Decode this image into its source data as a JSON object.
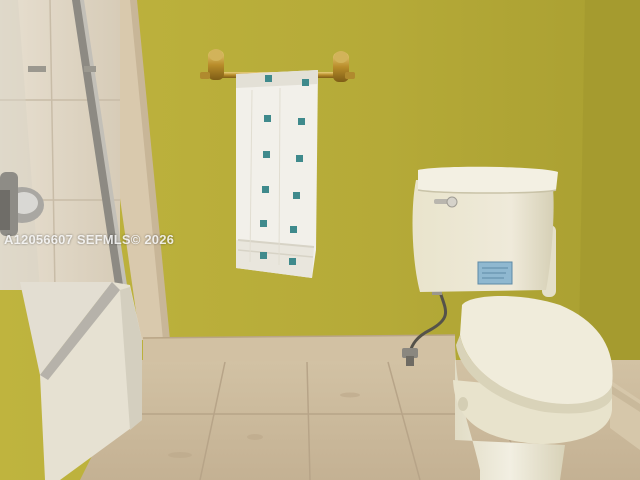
{
  "photo": {
    "watermark": "A12056607 SEFMLS© 2026"
  },
  "colors": {
    "wall": "#b7ad3a",
    "floor_tile": "#cdbb9c",
    "tub": "#e6e1d2",
    "toilet": "#ebe6cf",
    "towel": "#f2f0ea",
    "towel_squares": "#3f8a8c"
  },
  "objects": {
    "shower_door": "glass-sliding-door",
    "towel_bar": "brass-towel-bar",
    "towel": "white-towel-with-teal-squares",
    "toilet": "two-piece-toilet",
    "tank_label": "blue-sticker",
    "supply_line": "water-supply-line",
    "floor": "marble-tile-floor",
    "baseboard": "stone-baseboard"
  }
}
